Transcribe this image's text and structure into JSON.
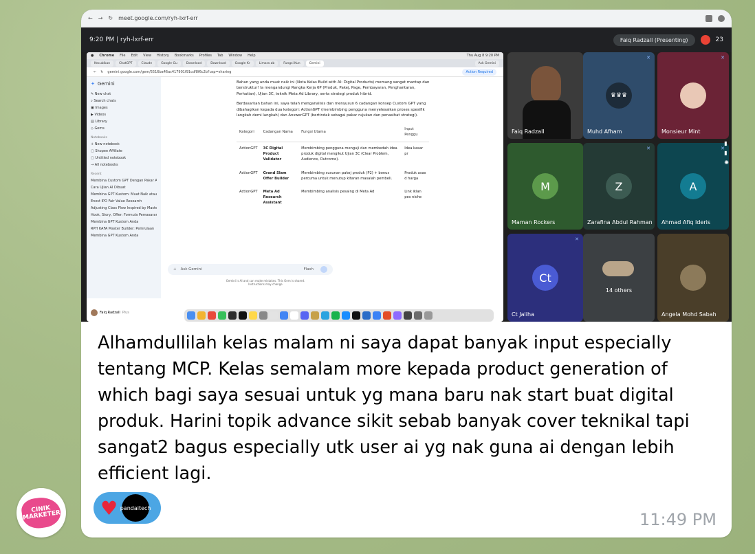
{
  "outer_browser": {
    "url": "meet.google.com/ryh-lxrf-err"
  },
  "meet": {
    "time_code": "9:20 PM | ryh-lxrf-err",
    "presenting": "Faiq Radzall (Presenting)",
    "participant_count": "23"
  },
  "mac_menu": [
    "Chrome",
    "File",
    "Edit",
    "View",
    "History",
    "Bookmarks",
    "Profiles",
    "Tab",
    "Window",
    "Help"
  ],
  "mac_clock": "Thu Aug 8 9:20 PM",
  "tabs": [
    "Kecubikan",
    "ChatGPT",
    "Claude",
    "Google Gu",
    "Download",
    "Download",
    "Google Kr",
    "Limara ab",
    "Fungsi Kun",
    "Gemini"
  ],
  "inner_url": "gemini.google.com/gem/5516ba46ac417901f91cdf8f6c2b?usp=sharing",
  "inner_action": "Action Required",
  "gemini_tab": "Ask Gemini",
  "gemini": {
    "brand": "Gemini",
    "nav": [
      "New chat",
      "Search chats",
      "Images",
      "Videos",
      "Library",
      "Gems"
    ],
    "notebooks_hd": "Notebooks",
    "notebooks": [
      "New notebook",
      "Shopee Affiliate",
      "Untitled notebook",
      "All notebooks"
    ],
    "recent_hd": "Recent",
    "recent": [
      "Membina Custom GPT Dengan Pakar AI",
      "Cara Ujian AI Dibuat",
      "Membina GPT Kustom: Muat Naik atau ...",
      "Enest IPO Fair Value Research",
      "Adjusting Class Flow Inspired by Maste...",
      "Hook, Story, Offer: Formula Pemasaran",
      "Membina GPT Kustom Anda",
      "RPH KAFA Master Builder: Pemrulaan",
      "Membina GPT Kustom Anda"
    ],
    "user": "Faiq Radzall",
    "user_plan": "Plus",
    "p1": "Bahan yang anda muat naik ini (Nota Kelas Build with AI: Digital Products) memang sangat mantap dan berstruktur! Ia mengandungi Rangka Kerja 6P (Produk, Pakej, Page, Pembayaran, Penghantaran, Perhatian), Ujian 3C, teknik Meta Ad Library, serta strategi produk hibrid.",
    "p2": "Berdasarkan bahan ini, saya telah menganalisis dan menyusun 6 cadangan konsep Custom GPT yang dibahagikan kepada dua kategori: ActionGPT (membimbing pengguna menyelesaikan proses spesifik langkah demi langkah) dan AnswerGPT (bertindak sebagai pakar rujukan dan penasihat strategi).",
    "table_headers": [
      "Kategori",
      "Cadangan Nama",
      "Fungsi Utama",
      "Input Penggu"
    ],
    "rows": [
      [
        "ActionGPT",
        "3C Digital Product Validator",
        "Membimbing pengguna menguji dan membedah idea produk digital mengikut Ujian 3C (Clear Problem, Audience, Outcome).",
        "Idea kasar pr"
      ],
      [
        "ActionGPT",
        "Grand Slam Offer Builder",
        "Membimbing susunan pakej produk (P2) + bonus percuma untuk menutup kitaran masalah pembeli.",
        "Produk asas d harga"
      ],
      [
        "ActionGPT",
        "Meta Ad Research Assistant",
        "Membimbing analisis pesaing di Meta Ad",
        "Link iklan pes niche"
      ]
    ],
    "ask_placeholder": "Ask Gemini",
    "mode": "Flash",
    "disclaimer": "Gemini is AI and can make mistakes. This Gem is shared. Instructions may change"
  },
  "participants": [
    {
      "name": "Faiq Radzall",
      "type": "video"
    },
    {
      "name": "Muhd Afham",
      "type": "image"
    },
    {
      "name": "Monsieur Mint",
      "type": "image"
    },
    {
      "name": "Maman Rockers",
      "initial": "M",
      "color": "#5c9a4b"
    },
    {
      "name": "Zarafina Abdul Rahman",
      "initial": "Z",
      "color": "#3c5b52"
    },
    {
      "name": "Ahmad Afiq Ideris",
      "initial": "A",
      "color": "#137c92"
    },
    {
      "name": "Ct Jaliha",
      "initial": "Ct",
      "color": "#4a5bd4"
    },
    {
      "name": "14 others",
      "type": "group"
    },
    {
      "name": "Angela Mohd Sabah",
      "type": "image"
    }
  ],
  "message": "Alhamdullilah kelas malam ni saya dapat banyak input especially tentang MCP. Kelas semalam more kepada product generation of which bagi saya sesuai untuk yg mana baru nak start buat digital produk. Harini topik advance sikit sebab banyak cover teknikal tapi sangat2 bagus especially utk user ai yg nak guna ai dengan lebih efficient lagi.",
  "reaction": {
    "emoji": "♥",
    "reactor": "pandaitech"
  },
  "time": "11:49 PM",
  "sender_logo": "CINIK MARKETER"
}
